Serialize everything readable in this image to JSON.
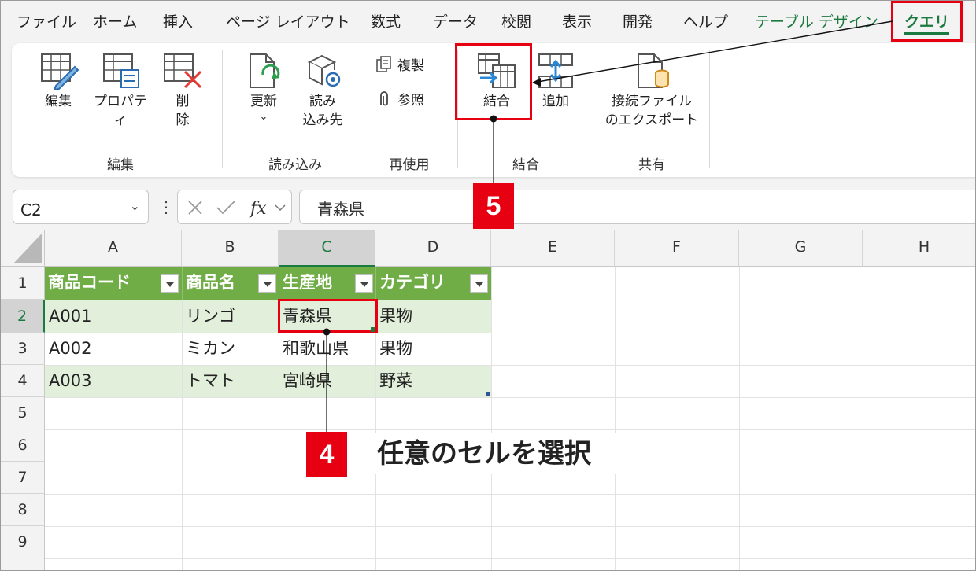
{
  "menu": {
    "tabs": [
      "ファイル",
      "ホーム",
      "挿入",
      "ページ レイアウト",
      "数式",
      "データ",
      "校閲",
      "表示",
      "開発",
      "ヘルプ",
      "テーブル デザイン",
      "クエリ"
    ]
  },
  "ribbon": {
    "edit_group": {
      "label": "編集",
      "edit": "編集",
      "properties": "プロパティ",
      "delete_1": "削",
      "delete_2": "除"
    },
    "load_group": {
      "label": "読み込み",
      "refresh": "更新",
      "load_to_1": "読み",
      "load_to_2": "込み先"
    },
    "reuse_group": {
      "label": "再使用",
      "duplicate": "複製",
      "reference": "参照"
    },
    "combine_group": {
      "label": "結合",
      "merge": "結合",
      "append": "追加"
    },
    "share_group": {
      "label": "共有",
      "export_1": "接続ファイル",
      "export_2": "のエクスポート"
    }
  },
  "formula_bar": {
    "name_box": "C2",
    "formula": "青森県"
  },
  "sheet": {
    "columns": [
      "A",
      "B",
      "C",
      "D",
      "E",
      "F",
      "G",
      "H"
    ],
    "rows": [
      "1",
      "2",
      "3",
      "4",
      "5",
      "6",
      "7",
      "8",
      "9"
    ],
    "table_headers": [
      "商品コード",
      "商品名",
      "生産地",
      "カテゴリ"
    ],
    "table_rows": [
      [
        "A001",
        "リンゴ",
        "青森県",
        "果物"
      ],
      [
        "A002",
        "ミカン",
        "和歌山県",
        "果物"
      ],
      [
        "A003",
        "トマト",
        "宮崎県",
        "野菜"
      ]
    ]
  },
  "annotations": {
    "step4_number": "4",
    "step4_text": "任意のセルを選択",
    "step5_number": "5"
  },
  "colors": {
    "accent_green": "#1b7a3f",
    "table_header": "#70ad47",
    "table_band": "#e2efda",
    "highlight_red": "#e60012"
  }
}
